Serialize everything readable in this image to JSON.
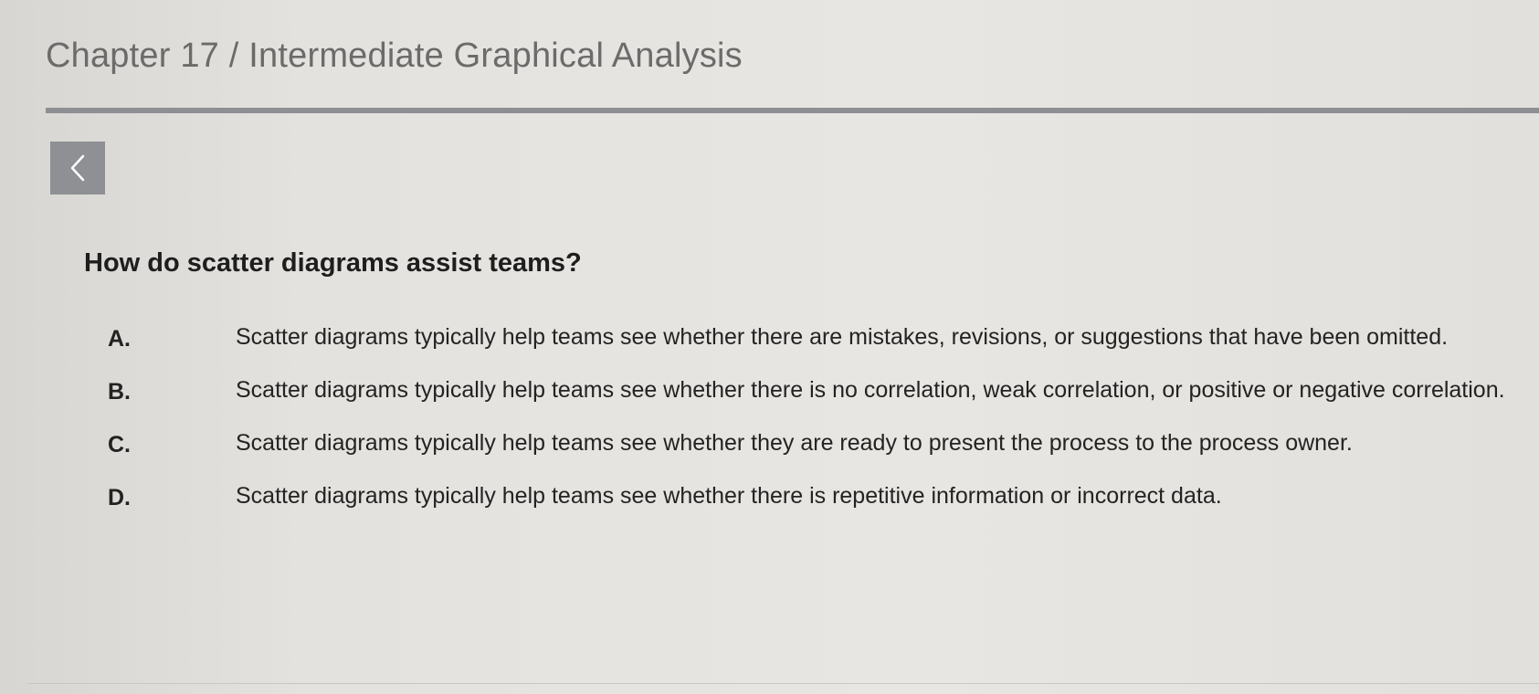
{
  "header": {
    "title": "Chapter 17 / Intermediate Graphical Analysis"
  },
  "nav": {
    "back_icon": "chevron-left-icon"
  },
  "question": {
    "text": "How do scatter diagrams assist teams?"
  },
  "options": [
    {
      "letter": "A.",
      "text": "Scatter diagrams typically help teams see whether there are mistakes, revisions, or suggestions that have been omitted."
    },
    {
      "letter": "B.",
      "text": "Scatter diagrams typically help teams see whether there is no correlation, weak correlation, or positive or negative correlation."
    },
    {
      "letter": "C.",
      "text": "Scatter diagrams typically help teams see whether they are ready to present the process to the process owner."
    },
    {
      "letter": "D.",
      "text": "Scatter diagrams typically help teams see whether there is repetitive information or incorrect data."
    }
  ],
  "colors": {
    "title": "#6b6b6b",
    "rule": "#8d8f93",
    "back_button": "#8e9094",
    "background": "#e6e4e0"
  }
}
